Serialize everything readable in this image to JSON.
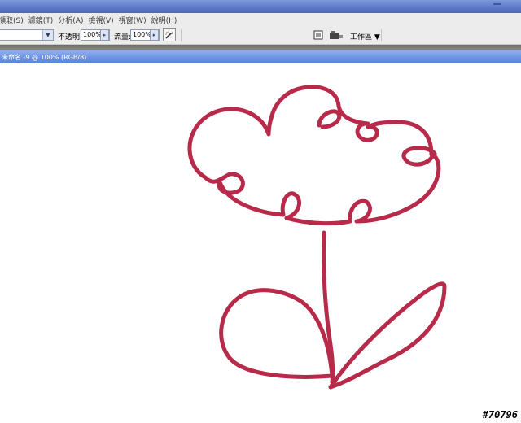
{
  "menu": {
    "items": [
      "擷取(S)",
      "濾鏡(T)",
      "分析(A)",
      "檢視(V)",
      "視窗(W)",
      "說明(H)"
    ]
  },
  "options": {
    "opacity_label": "不透明:",
    "opacity_value": "100%",
    "flow_label": "流量:",
    "flow_value": "100%",
    "workspace_label": "工作區 ▼"
  },
  "document": {
    "title": "未命名 -9 @ 100% (RGB/8)"
  },
  "canvas": {
    "stroke_color": "#b82a4a",
    "background": "#ffffff"
  },
  "watermark": "#70796",
  "icons": {
    "airbrush": "airbrush-icon",
    "palette": "palette-well-icon",
    "brush_preset": "brush-preset-icon"
  }
}
